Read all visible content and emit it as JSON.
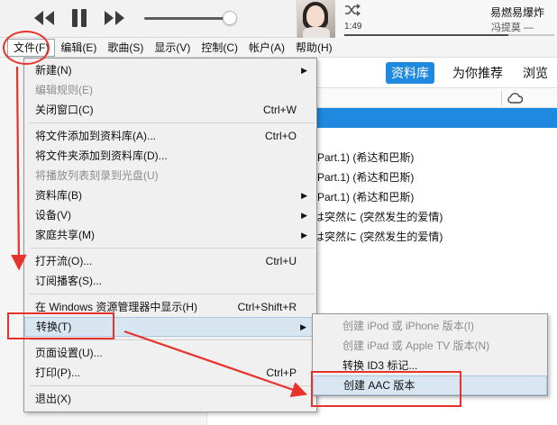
{
  "player": {
    "elapsed": "1:49",
    "song_title": "易燃易爆炸",
    "song_artist": "冯提莫 —",
    "progress_fraction": 0.78,
    "volume_fraction": 0.9
  },
  "menubar": [
    {
      "id": "file",
      "label": "文件(F)",
      "active": true
    },
    {
      "id": "edit",
      "label": "编辑(E)"
    },
    {
      "id": "song",
      "label": "歌曲(S)"
    },
    {
      "id": "view",
      "label": "显示(V)"
    },
    {
      "id": "control",
      "label": "控制(C)"
    },
    {
      "id": "account",
      "label": "帐户(A)"
    },
    {
      "id": "help",
      "label": "帮助(H)"
    }
  ],
  "nav_tabs": [
    {
      "label": "资料库",
      "selected": true
    },
    {
      "label": "为你推荐"
    },
    {
      "label": "浏览"
    }
  ],
  "tracks": [
    "(Part.1) (希达和巴斯)",
    "(Part.1) (希达和巴斯)",
    "(Part.1) (希达和巴斯)",
    "は突然に (突然发生的爱情)",
    "は突然に (突然发生的爱情)"
  ],
  "file_menu": [
    {
      "label": "新建(N)",
      "submenu": true
    },
    {
      "label": "编辑规则(E)",
      "disabled": true
    },
    {
      "label": "关闭窗口(C)",
      "shortcut": "Ctrl+W"
    },
    {
      "separator": true
    },
    {
      "label": "将文件添加到资料库(A)...",
      "shortcut": "Ctrl+O"
    },
    {
      "label": "将文件夹添加到资料库(D)..."
    },
    {
      "label": "将播放列表刻录到光盘(U)",
      "disabled": true
    },
    {
      "label": "资料库(B)",
      "submenu": true
    },
    {
      "label": "设备(V)",
      "submenu": true
    },
    {
      "label": "家庭共享(M)",
      "submenu": true
    },
    {
      "separator": true
    },
    {
      "label": "打开流(O)...",
      "shortcut": "Ctrl+U"
    },
    {
      "label": "订阅播客(S)..."
    },
    {
      "separator": true
    },
    {
      "label": "在 Windows 资源管理器中显示(H)",
      "shortcut": "Ctrl+Shift+R"
    },
    {
      "label": "转换(T)",
      "submenu": true,
      "highlighted": true
    },
    {
      "separator": true
    },
    {
      "label": "页面设置(U)..."
    },
    {
      "label": "打印(P)...",
      "shortcut": "Ctrl+P"
    },
    {
      "separator": true
    },
    {
      "label": "退出(X)"
    }
  ],
  "convert_menu": [
    {
      "label": "创建 iPod 或 iPhone 版本(I)",
      "disabled": true
    },
    {
      "label": "创建 iPad 或 Apple TV 版本(N)",
      "disabled": true
    },
    {
      "label": "转换 ID3 标记..."
    },
    {
      "label": "创建 AAC 版本",
      "highlighted": true
    }
  ],
  "colors": {
    "accent": "#1e89de",
    "annotation": "#e8332c",
    "menu_bg": "#f0f0f0",
    "menu_highlight": "#d8e6f2"
  }
}
